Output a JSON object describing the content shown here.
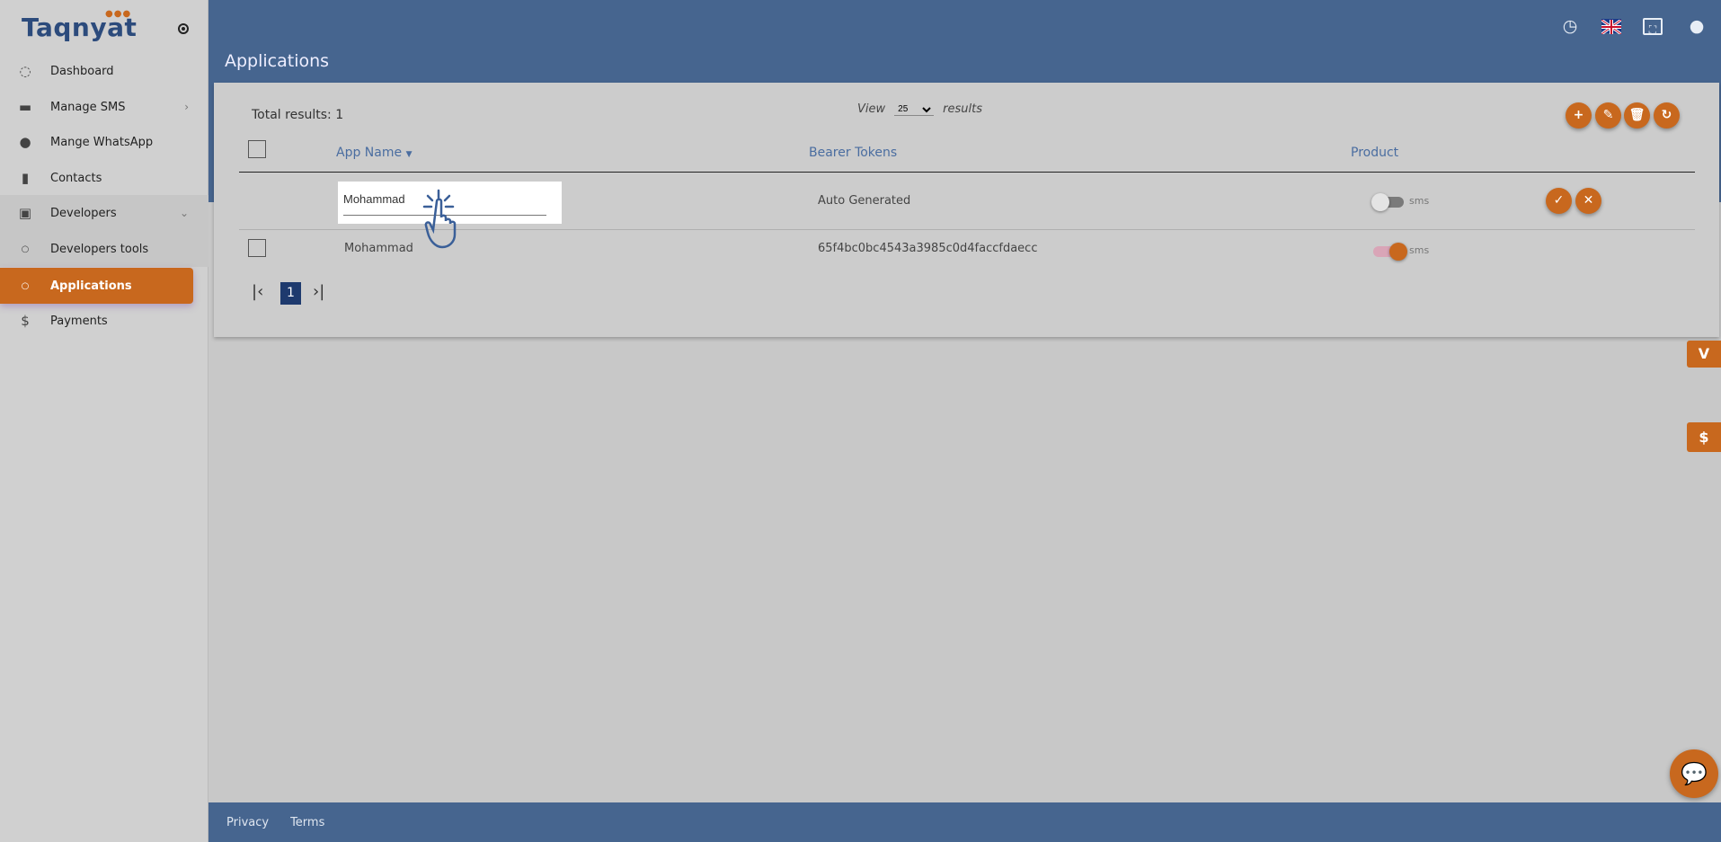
{
  "brand": {
    "name": "Taqnyat",
    "accent": "#c8681e",
    "primary": "#46658f"
  },
  "sidebar": {
    "items": [
      {
        "label": "Dashboard",
        "icon": "dashboard-icon"
      },
      {
        "label": "Manage SMS",
        "icon": "chat-icon"
      },
      {
        "label": "Mange WhatsApp",
        "icon": "whatsapp-icon"
      },
      {
        "label": "Contacts",
        "icon": "contacts-book-icon"
      },
      {
        "label": "Developers",
        "icon": "developers-icon"
      },
      {
        "label": "Developers tools",
        "icon": "circle-icon"
      },
      {
        "label": "Applications",
        "icon": "circle-icon",
        "active": true
      },
      {
        "label": "Payments",
        "icon": "dollar-icon"
      }
    ]
  },
  "header": {
    "title": "Applications",
    "icons": [
      "clock-icon",
      "uk-flag-icon",
      "fullscreen-icon",
      "account-icon"
    ]
  },
  "toolbar": {
    "total": "Total results: 1",
    "view_label": "View",
    "page_size": "25",
    "results_label": "results"
  },
  "table": {
    "columns": [
      "App Name",
      "Bearer Tokens",
      "Product"
    ],
    "edit_row": {
      "app_name": "Mohammad",
      "token": "Auto Generated",
      "product": "sms",
      "enabled": false
    },
    "rows": [
      {
        "app_name": "Mohammad",
        "token": "65f4bc0bc4543a3985c0d4faccfdaecc",
        "product": "sms",
        "enabled": true
      }
    ]
  },
  "pagination": {
    "current": "1"
  },
  "footer": {
    "privacy": "Privacy",
    "terms": "Terms"
  }
}
